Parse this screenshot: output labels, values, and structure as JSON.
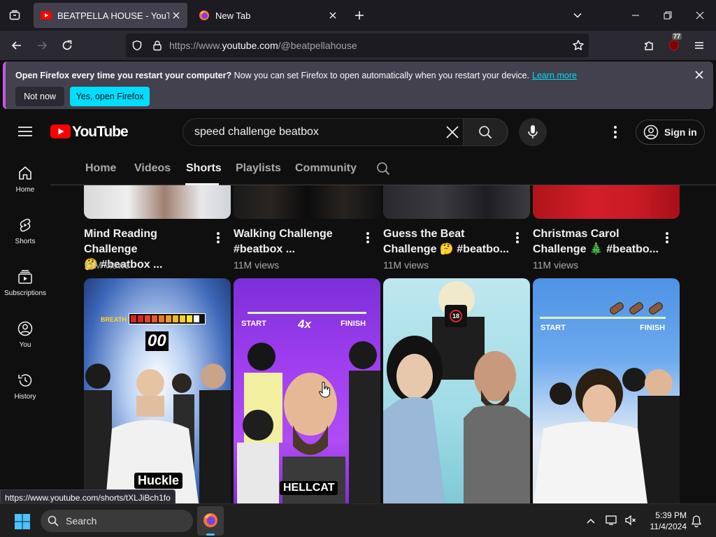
{
  "browser": {
    "tabs": [
      {
        "title": "BEATPELLA HOUSE - YouTube",
        "active": true
      },
      {
        "title": "New Tab",
        "active": false
      }
    ],
    "url_prefix": "https://www.",
    "url_domain": "youtube.com",
    "url_path": "/@beatpellahouse",
    "extension_badge": "77",
    "infobar": {
      "bold": "Open Firefox every time you restart your computer?",
      "text": " Now you can set Firefox to open automatically when you restart your device.",
      "link": "Learn more",
      "btn_no": "Not now",
      "btn_yes": "Yes, open Firefox"
    },
    "status_url": "https://www.youtube.com/shorts/tXLJiBch1fo"
  },
  "youtube": {
    "logo": "YouTube",
    "search_query": "speed challenge beatbox",
    "sign_in": "Sign in",
    "sidebar": [
      {
        "label": "Home",
        "icon": "home-icon"
      },
      {
        "label": "Shorts",
        "icon": "shorts-icon"
      },
      {
        "label": "Subscriptions",
        "icon": "subscriptions-icon"
      },
      {
        "label": "You",
        "icon": "you-icon"
      },
      {
        "label": "History",
        "icon": "history-icon"
      }
    ],
    "channel_tabs": [
      "Home",
      "Videos",
      "Shorts",
      "Playlists",
      "Community"
    ],
    "selected_tab": "Shorts",
    "top_row": [
      {
        "title_1": "Mind Reading Challenge",
        "title_2": "🤔 #beatbox ...",
        "views": "11M views"
      },
      {
        "title_1": "Walking Challenge",
        "title_2": "#beatbox ...",
        "views": "11M views"
      },
      {
        "title_1": "Guess the Beat",
        "title_2": "Challenge 🤔 #beatbo...",
        "views": "11M views"
      },
      {
        "title_1": "Christmas Carol",
        "title_2": "Challenge 🎄 #beatbo...",
        "views": "11M views"
      }
    ],
    "bottom_row": [
      {
        "overlay_1": "BREATH",
        "overlay_2": "00",
        "caption": "Huckle"
      },
      {
        "overlay_1": "START",
        "overlay_2": "4x",
        "overlay_3": "FINISH",
        "caption": "HELLCAT"
      },
      {
        "overlay_1": "18"
      },
      {
        "overlay_1": "START",
        "overlay_3": "FINISH"
      }
    ]
  },
  "taskbar": {
    "search": "Search",
    "time": "5:39 PM",
    "date": "11/4/2024"
  }
}
